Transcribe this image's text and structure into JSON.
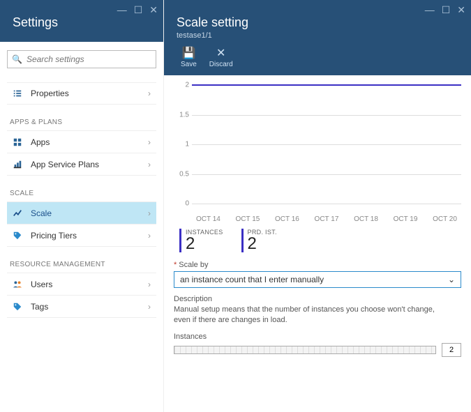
{
  "left": {
    "title": "Settings",
    "search_placeholder": "Search settings",
    "groups": [
      {
        "title": null,
        "items": [
          {
            "icon": "properties-icon",
            "label": "Properties"
          }
        ]
      },
      {
        "title": "APPS & PLANS",
        "items": [
          {
            "icon": "apps-icon",
            "label": "Apps"
          },
          {
            "icon": "plans-icon",
            "label": "App Service Plans"
          }
        ]
      },
      {
        "title": "SCALE",
        "items": [
          {
            "icon": "scale-icon",
            "label": "Scale",
            "active": true
          },
          {
            "icon": "pricing-icon",
            "label": "Pricing Tiers"
          }
        ]
      },
      {
        "title": "RESOURCE MANAGEMENT",
        "items": [
          {
            "icon": "users-icon",
            "label": "Users"
          },
          {
            "icon": "tags-icon",
            "label": "Tags"
          }
        ]
      }
    ]
  },
  "right": {
    "title": "Scale setting",
    "subtitle": "testase1/1",
    "toolbar": {
      "save": "Save",
      "discard": "Discard"
    },
    "stats": [
      {
        "label": "INSTANCES",
        "value": "2"
      },
      {
        "label": "PRD. IST.",
        "value": "2"
      }
    ],
    "scale_by": {
      "label": "Scale by",
      "value": "an instance count that I enter manually"
    },
    "description": {
      "label": "Description",
      "text": "Manual setup means that the number of instances you choose won't change, even if there are changes in load."
    },
    "instances": {
      "label": "Instances",
      "value": "2"
    }
  },
  "chart_data": {
    "type": "line",
    "title": "",
    "xlabel": "",
    "ylabel": "",
    "ylim": [
      0,
      2
    ],
    "yticks": [
      0,
      0.5,
      1,
      1.5,
      2
    ],
    "categories": [
      "OCT 14",
      "OCT 15",
      "OCT 16",
      "OCT 17",
      "OCT 18",
      "OCT 19",
      "OCT 20"
    ],
    "series": [
      {
        "name": "Instances",
        "values": [
          2,
          2,
          2,
          2,
          2,
          2,
          2
        ],
        "color": "#3b2fc4"
      }
    ]
  }
}
